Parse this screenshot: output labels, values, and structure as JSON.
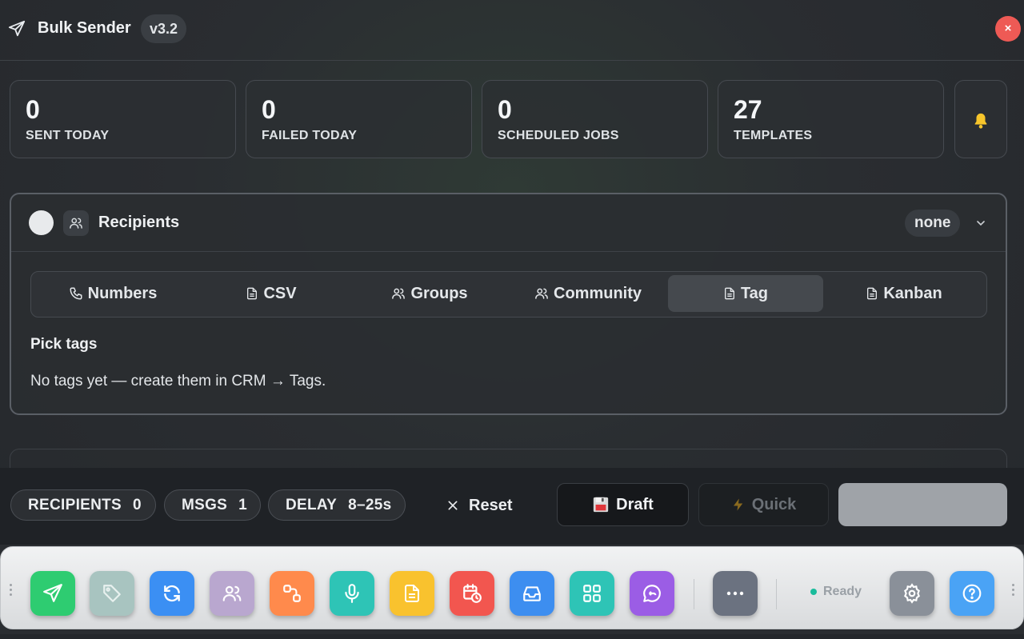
{
  "header": {
    "title": "Bulk Sender",
    "version": "v3.2",
    "close": "×"
  },
  "stats": [
    {
      "value": "0",
      "label": "SENT TODAY"
    },
    {
      "value": "0",
      "label": "FAILED TODAY"
    },
    {
      "value": "0",
      "label": "SCHEDULED JOBS"
    },
    {
      "value": "27",
      "label": "TEMPLATES"
    }
  ],
  "recipients": {
    "title": "Recipients",
    "badge": "none",
    "tabs": [
      {
        "label": "Numbers",
        "icon": "phone-icon"
      },
      {
        "label": "CSV",
        "icon": "file-icon"
      },
      {
        "label": "Groups",
        "icon": "users-icon"
      },
      {
        "label": "Community",
        "icon": "users-icon"
      },
      {
        "label": "Tag",
        "icon": "file-icon"
      },
      {
        "label": "Kanban",
        "icon": "file-icon"
      }
    ],
    "active_tab": "Tag",
    "pick_label": "Pick tags",
    "empty_message": "No tags yet — create them in CRM → Tags."
  },
  "actions": {
    "chips": [
      {
        "label": "RECIPIENTS",
        "value": "0"
      },
      {
        "label": "MSGS",
        "value": "1"
      },
      {
        "label": "DELAY",
        "value": "8–25s"
      }
    ],
    "reset": "Reset",
    "draft": "Draft",
    "quick": "Quick"
  },
  "dock": {
    "status": "Ready",
    "apps": [
      {
        "name": "send-app-icon",
        "color": "#2ecc71"
      },
      {
        "name": "tag-app-icon",
        "color": "#a8c4c0"
      },
      {
        "name": "sync-app-icon",
        "color": "#3b8ff3"
      },
      {
        "name": "contacts-app-icon",
        "color": "#b9a7cf"
      },
      {
        "name": "workflow-app-icon",
        "color": "#ff8a4c"
      },
      {
        "name": "microphone-app-icon",
        "color": "#2ec4b6"
      },
      {
        "name": "notes-app-icon",
        "color": "#f9c22e"
      },
      {
        "name": "calendar-app-icon",
        "color": "#f2564f"
      },
      {
        "name": "inbox-app-icon",
        "color": "#3d8ef0"
      },
      {
        "name": "apps-grid-app-icon",
        "color": "#2ec4b6"
      },
      {
        "name": "chat-app-icon",
        "color": "#9b5de5"
      },
      {
        "name": "more-app-icon",
        "color": "#6b7280"
      },
      {
        "name": "settings-app-icon",
        "color": "#8a9099"
      },
      {
        "name": "help-app-icon",
        "color": "#4aa3f5"
      }
    ]
  }
}
